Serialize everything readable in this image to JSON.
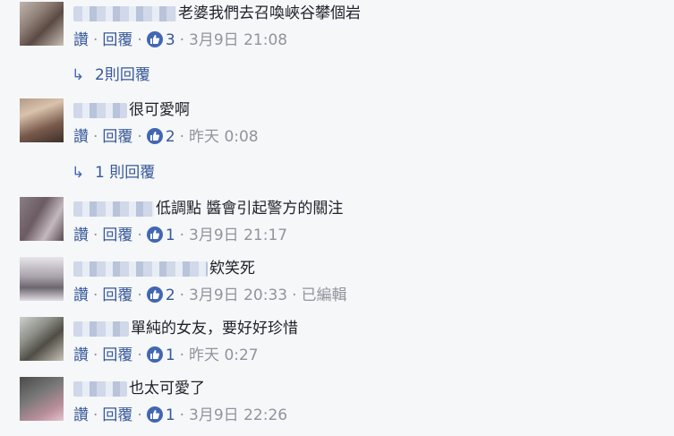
{
  "labels": {
    "like": "讚",
    "reply": "回覆",
    "dot": "·"
  },
  "comments": [
    {
      "text": "老婆我們去召喚峽谷攀個岩",
      "likes": "3",
      "time": "3月9日 21:08",
      "edited": ""
    },
    {
      "text": "很可愛啊",
      "likes": "2",
      "time": "昨天 0:08",
      "edited": ""
    },
    {
      "text": "低調點 醬會引起警方的關注",
      "likes": "1",
      "time": "3月9日 21:17",
      "edited": ""
    },
    {
      "text": "欸笑死",
      "likes": "2",
      "time": "3月9日 20:33",
      "edited": "已編輯"
    },
    {
      "text": "單純的女友，要好好珍惜",
      "likes": "1",
      "time": "昨天 0:27",
      "edited": ""
    },
    {
      "text": "也太可愛了",
      "likes": "1",
      "time": "3月9日 22:26",
      "edited": ""
    }
  ],
  "reply_links": [
    {
      "label": "2則回覆"
    },
    {
      "label": "1 則回覆"
    }
  ],
  "colors": {
    "link": "#365899",
    "like_badge": "#4267b2",
    "meta": "#90949c",
    "background": "#f6f7f9"
  },
  "icons": {
    "reply_arrow": "reply-arrow-icon",
    "like_badge": "thumbs-up-icon"
  }
}
